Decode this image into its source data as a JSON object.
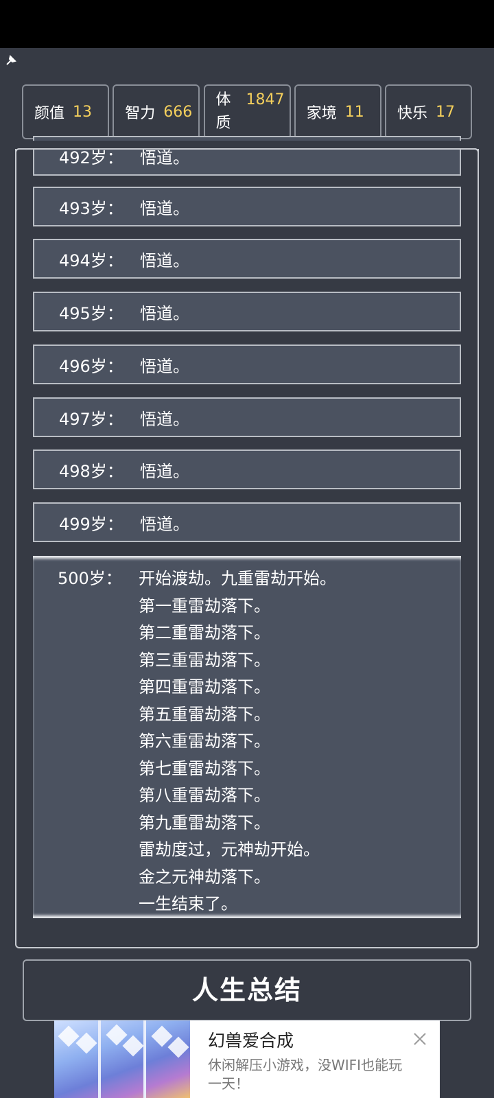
{
  "stats": [
    {
      "label": "颜值",
      "value": "13"
    },
    {
      "label": "智力",
      "value": "666"
    },
    {
      "label": "体质",
      "value": "1847"
    },
    {
      "label": "家境",
      "value": "11"
    },
    {
      "label": "快乐",
      "value": "17"
    }
  ],
  "log": [
    {
      "age": "492岁：",
      "text": "悟道。"
    },
    {
      "age": "493岁：",
      "text": "悟道。"
    },
    {
      "age": "494岁：",
      "text": "悟道。"
    },
    {
      "age": "495岁：",
      "text": "悟道。"
    },
    {
      "age": "496岁：",
      "text": "悟道。"
    },
    {
      "age": "497岁：",
      "text": "悟道。"
    },
    {
      "age": "498岁：",
      "text": "悟道。"
    },
    {
      "age": "499岁：",
      "text": "悟道。"
    }
  ],
  "final_entry": {
    "age": "500岁：",
    "lines": [
      "开始渡劫。九重雷劫开始。",
      "第一重雷劫落下。",
      "第二重雷劫落下。",
      "第三重雷劫落下。",
      "第四重雷劫落下。",
      "第五重雷劫落下。",
      "第六重雷劫落下。",
      "第七重雷劫落下。",
      "第八重雷劫落下。",
      "第九重雷劫落下。",
      "雷劫度过，元神劫开始。",
      "金之元神劫落下。",
      "一生结束了。"
    ]
  },
  "summary_button": "人生总结",
  "ad": {
    "title": "幻兽爱合成",
    "description": "休闲解压小游戏，没WIFI也能玩一天！"
  },
  "colors": {
    "background": "#363a44",
    "entry_bg": "#4b5260",
    "stat_value": "#f4cf5c"
  }
}
